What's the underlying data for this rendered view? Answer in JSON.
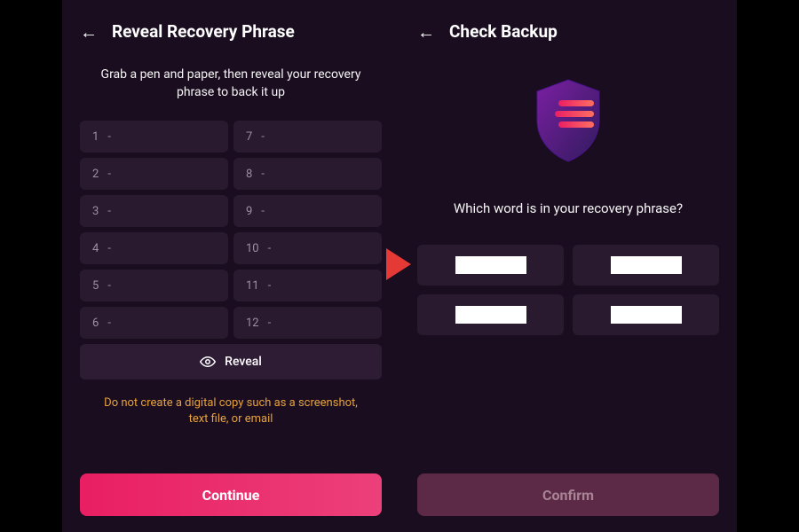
{
  "left": {
    "title": "Reveal Recovery Phrase",
    "instruction": "Grab a pen and paper, then reveal your recovery phrase to back it up",
    "words": [
      {
        "n": "1",
        "w": "-"
      },
      {
        "n": "7",
        "w": "-"
      },
      {
        "n": "2",
        "w": "-"
      },
      {
        "n": "8",
        "w": "-"
      },
      {
        "n": "3",
        "w": "-"
      },
      {
        "n": "9",
        "w": "-"
      },
      {
        "n": "4",
        "w": "-"
      },
      {
        "n": "10",
        "w": "-"
      },
      {
        "n": "5",
        "w": "-"
      },
      {
        "n": "11",
        "w": "-"
      },
      {
        "n": "6",
        "w": "-"
      },
      {
        "n": "12",
        "w": "-"
      }
    ],
    "reveal_label": "Reveal",
    "warning": "Do not create a digital copy such as a screenshot, text file, or email",
    "continue_label": "Continue"
  },
  "right": {
    "title": "Check Backup",
    "question": "Which word is in your recovery phrase?",
    "confirm_label": "Confirm"
  }
}
